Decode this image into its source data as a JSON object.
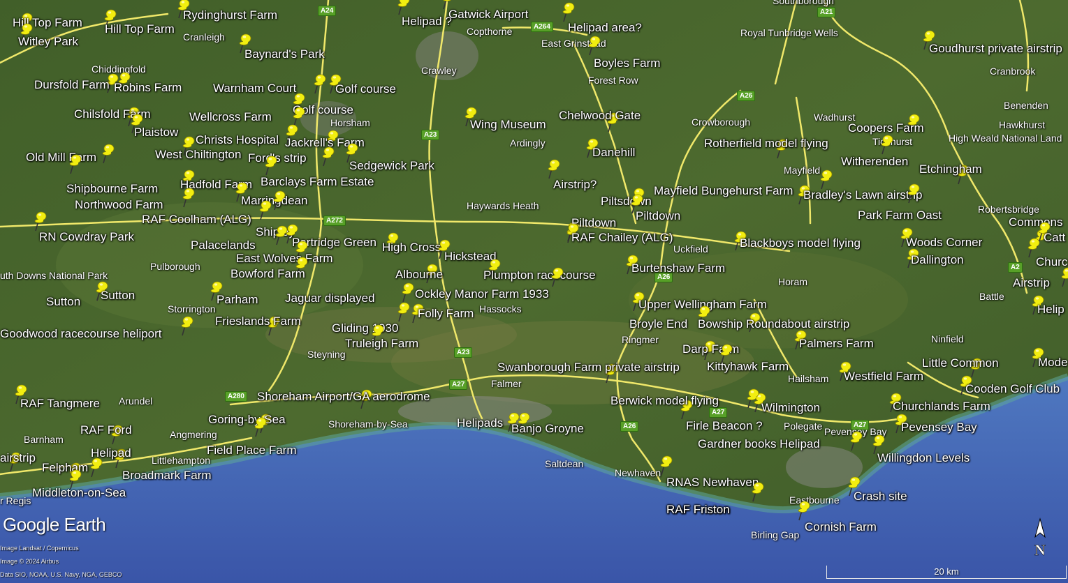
{
  "branding": {
    "logo": "Google Earth"
  },
  "credits": [
    "Image Landsat / Copernicus",
    "Image © 2024 Airbus",
    "Data SIO, NOAA, U.S. Navy, NGA, GEBCO"
  ],
  "scale": {
    "label": "20 km"
  },
  "compass": {
    "label": "N",
    "icon": "north-arrow-icon"
  },
  "colors": {
    "pin": "#f2ee10",
    "road": "#f0e86a",
    "sea": "#4764b8",
    "land": "#4a6a30"
  },
  "pins": [
    {
      "label": "Hill Top Farm",
      "icon": "yellow-pushpin-icon"
    },
    {
      "label": "Hill Top Farm",
      "icon": "yellow-pushpin-icon"
    },
    {
      "label": "Rydinghurst Farm",
      "icon": "yellow-pushpin-icon"
    },
    {
      "label": "Witley Park",
      "icon": "yellow-pushpin-icon"
    },
    {
      "label": "Baynard's Park",
      "icon": "yellow-pushpin-icon"
    },
    {
      "label": "Dursfold Farm",
      "icon": "yellow-pushpin-icon"
    },
    {
      "label": "Robins Farm",
      "icon": "yellow-pushpin-icon"
    },
    {
      "label": "Warnham Court",
      "icon": "yellow-pushpin-icon"
    },
    {
      "label": "Golf course",
      "icon": "yellow-pushpin-icon"
    },
    {
      "label": "Golf course",
      "icon": "yellow-pushpin-icon"
    },
    {
      "label": "Chilsfold Farm",
      "icon": "yellow-pushpin-icon"
    },
    {
      "label": "Plaistow",
      "icon": "yellow-pushpin-icon"
    },
    {
      "label": "Wellcross Farm",
      "icon": "yellow-pushpin-icon"
    },
    {
      "label": "Christs Hospital",
      "icon": "yellow-pushpin-icon"
    },
    {
      "label": "West Chiltington",
      "icon": "yellow-pushpin-icon"
    },
    {
      "label": "Jackrell's Farm",
      "icon": "yellow-pushpin-icon"
    },
    {
      "label": "Ford's strip",
      "icon": "yellow-pushpin-icon"
    },
    {
      "label": "Sedgewick Park",
      "icon": "yellow-pushpin-icon"
    },
    {
      "label": "Old Mill Farm",
      "icon": "yellow-pushpin-icon"
    },
    {
      "label": "Shipbourne Farm",
      "icon": "yellow-pushpin-icon"
    },
    {
      "label": "Hadfold Farm",
      "icon": "yellow-pushpin-icon"
    },
    {
      "label": "Barclays Farm Estate",
      "icon": "yellow-pushpin-icon"
    },
    {
      "label": "Northwood Farm",
      "icon": "yellow-pushpin-icon"
    },
    {
      "label": "Marringdean",
      "icon": "yellow-pushpin-icon"
    },
    {
      "label": "RAF Coolham (ALG)",
      "icon": "yellow-pushpin-icon"
    },
    {
      "label": "Shipley",
      "icon": "yellow-pushpin-icon"
    },
    {
      "label": "RN Cowdray Park",
      "icon": "yellow-pushpin-icon"
    },
    {
      "label": "Palacelands",
      "icon": "yellow-pushpin-icon"
    },
    {
      "label": "Partridge Green",
      "icon": "yellow-pushpin-icon"
    },
    {
      "label": "East Wolves Farm",
      "icon": "yellow-pushpin-icon"
    },
    {
      "label": "Bowford Farm",
      "icon": "yellow-pushpin-icon"
    },
    {
      "label": "Sutton",
      "icon": "yellow-pushpin-icon"
    },
    {
      "label": "Sutton",
      "icon": "yellow-pushpin-icon"
    },
    {
      "label": "Parham",
      "icon": "yellow-pushpin-icon"
    },
    {
      "label": "Jaguar displayed",
      "icon": "yellow-pushpin-icon"
    },
    {
      "label": "Frieslands Farm",
      "icon": "yellow-pushpin-icon"
    },
    {
      "label": "Goodwood racecourse heliport",
      "icon": "yellow-pushpin-icon"
    },
    {
      "label": "Gliding 1930",
      "icon": "yellow-pushpin-icon"
    },
    {
      "label": "Truleigh Farm",
      "icon": "yellow-pushpin-icon"
    },
    {
      "label": "RAF Tangmere",
      "icon": "yellow-pushpin-icon"
    },
    {
      "label": "Shoreham Airport/GA aerodrome",
      "icon": "yellow-pushpin-icon"
    },
    {
      "label": "RAF Ford",
      "icon": "yellow-pushpin-icon"
    },
    {
      "label": "Goring-by-Sea",
      "icon": "yellow-pushpin-icon"
    },
    {
      "label": "Field Place Farm",
      "icon": "yellow-pushpin-icon"
    },
    {
      "label": "Helipad",
      "icon": "yellow-pushpin-icon"
    },
    {
      "label": "Felpham",
      "icon": "yellow-pushpin-icon"
    },
    {
      "label": "airstrip",
      "icon": "yellow-pushpin-icon"
    },
    {
      "label": "Broadmark Farm",
      "icon": "yellow-pushpin-icon"
    },
    {
      "label": "Middleton-on-Sea",
      "icon": "yellow-pushpin-icon"
    },
    {
      "label": "Helipad ?",
      "icon": "yellow-pushpin-icon"
    },
    {
      "label": "Gatwick Airport",
      "icon": "yellow-pushpin-icon"
    },
    {
      "label": "Helipad area?",
      "icon": "yellow-pushpin-icon"
    },
    {
      "label": "Boyles Farm",
      "icon": "yellow-pushpin-icon"
    },
    {
      "label": "Wing Museum",
      "icon": "yellow-pushpin-icon"
    },
    {
      "label": "Chelwood Gate",
      "icon": "yellow-pushpin-icon"
    },
    {
      "label": "Danehill",
      "icon": "yellow-pushpin-icon"
    },
    {
      "label": "Airstrip?",
      "icon": "yellow-pushpin-icon"
    },
    {
      "label": "Piltsdown",
      "icon": "yellow-pushpin-icon"
    },
    {
      "label": "Piltdown",
      "icon": "yellow-pushpin-icon"
    },
    {
      "label": "Piltdown",
      "icon": "yellow-pushpin-icon"
    },
    {
      "label": "RAF Chailey (ALG)",
      "icon": "yellow-pushpin-icon"
    },
    {
      "label": "High Cross",
      "icon": "yellow-pushpin-icon"
    },
    {
      "label": "Hickstead",
      "icon": "yellow-pushpin-icon"
    },
    {
      "label": "Albourne",
      "icon": "yellow-pushpin-icon"
    },
    {
      "label": "Plumpton racecourse",
      "icon": "yellow-pushpin-icon"
    },
    {
      "label": "Ockley Manor Farm 1933",
      "icon": "yellow-pushpin-icon"
    },
    {
      "label": "Folly Farm",
      "icon": "yellow-pushpin-icon"
    },
    {
      "label": "Swanborough Farm private airstrip",
      "icon": "yellow-pushpin-icon"
    },
    {
      "label": "Helipads",
      "icon": "yellow-pushpin-icon"
    },
    {
      "label": "Banjo Groyne",
      "icon": "yellow-pushpin-icon"
    },
    {
      "label": "Goudhurst private airstrip",
      "icon": "yellow-pushpin-icon"
    },
    {
      "label": "Coopers Farm",
      "icon": "yellow-pushpin-icon"
    },
    {
      "label": "Rotherfield model flying",
      "icon": "yellow-pushpin-icon"
    },
    {
      "label": "Witherenden",
      "icon": "yellow-pushpin-icon"
    },
    {
      "label": "Etchingham",
      "icon": "yellow-pushpin-icon"
    },
    {
      "label": "Mayfield Bungehurst Farm",
      "icon": "yellow-pushpin-icon"
    },
    {
      "label": "Bradley's Lawn airstrip",
      "icon": "yellow-pushpin-icon"
    },
    {
      "label": "Park Farm Oast",
      "icon": "yellow-pushpin-icon"
    },
    {
      "label": "Blackboys model flying",
      "icon": "yellow-pushpin-icon"
    },
    {
      "label": "Woods Corner",
      "icon": "yellow-pushpin-icon"
    },
    {
      "label": "Dallington",
      "icon": "yellow-pushpin-icon"
    },
    {
      "label": "Burtenshaw Farm",
      "icon": "yellow-pushpin-icon"
    },
    {
      "label": "Upper Wellingham Farm",
      "icon": "yellow-pushpin-icon"
    },
    {
      "label": "Broyle End",
      "icon": "yellow-pushpin-icon"
    },
    {
      "label": "Bowship Roundabout airstrip",
      "icon": "yellow-pushpin-icon"
    },
    {
      "label": "Palmers Farm",
      "icon": "yellow-pushpin-icon"
    },
    {
      "label": "Darp Farm",
      "icon": "yellow-pushpin-icon"
    },
    {
      "label": "Kittyhawk Farm",
      "icon": "yellow-pushpin-icon"
    },
    {
      "label": "Westfield Farm",
      "icon": "yellow-pushpin-icon"
    },
    {
      "label": "Little Common",
      "icon": "yellow-pushpin-icon"
    },
    {
      "label": "Cooden Golf Club",
      "icon": "yellow-pushpin-icon"
    },
    {
      "label": "Berwick model flying",
      "icon": "yellow-pushpin-icon"
    },
    {
      "label": "Wilmington",
      "icon": "yellow-pushpin-icon"
    },
    {
      "label": "Churchlands Farm",
      "icon": "yellow-pushpin-icon"
    },
    {
      "label": "Firle Beacon ?",
      "icon": "yellow-pushpin-icon"
    },
    {
      "label": "Pevensey Bay",
      "icon": "yellow-pushpin-icon"
    },
    {
      "label": "Gardner books Helipad",
      "icon": "yellow-pushpin-icon"
    },
    {
      "label": "Willingdon Levels",
      "icon": "yellow-pushpin-icon"
    },
    {
      "label": "RNAS Newhaven",
      "icon": "yellow-pushpin-icon"
    },
    {
      "label": "RAF Friston",
      "icon": "yellow-pushpin-icon"
    },
    {
      "label": "Crash site",
      "icon": "yellow-pushpin-icon"
    },
    {
      "label": "Cornish Farm",
      "icon": "yellow-pushpin-icon"
    },
    {
      "label": "Commons",
      "icon": "yellow-pushpin-icon"
    },
    {
      "label": "Catt",
      "icon": "yellow-pushpin-icon"
    },
    {
      "label": "Churc",
      "icon": "yellow-pushpin-icon"
    },
    {
      "label": "Airstrip",
      "icon": "yellow-pushpin-icon"
    },
    {
      "label": "Helip",
      "icon": "yellow-pushpin-icon"
    },
    {
      "label": "Mode",
      "icon": "yellow-pushpin-icon"
    },
    {
      "label": "RAF Friston",
      "icon": "yellow-pushpin-icon"
    }
  ],
  "places": [
    "Cranleigh",
    "Chiddingfold",
    "Horsham",
    "Crawley",
    "Copthorne",
    "East Grinstead",
    "Forest Row",
    "Ardingly",
    "Haywards Heath",
    "Pulborough",
    "Storrington",
    "Steyning",
    "Hassocks",
    "Falmer",
    "Arundel",
    "Angmering",
    "Barnham",
    "Littlehampton",
    "Shoreham-by-Sea",
    "Saltdean",
    "Newhaven",
    "Ringmer",
    "Uckfield",
    "Horam",
    "Hailsham",
    "Polegate",
    "Eastbourne",
    "Birling Gap",
    "Pevensey Bay",
    "Ninfield",
    "Battle",
    "Robertsbridge",
    "Mayfield",
    "Crowborough",
    "Wadhurst",
    "Ticehurst",
    "Cranbrook",
    "Benenden",
    "Hawkhurst",
    "High Weald National Land",
    "Royal Tunbridge Wells",
    "Southborough",
    "uth Downs National Park",
    "r Regis"
  ],
  "roads": [
    "A24",
    "A264",
    "A21",
    "A26",
    "A23",
    "A272",
    "A23",
    "A27",
    "A280",
    "A27",
    "A26",
    "A26",
    "A27",
    "A2"
  ]
}
